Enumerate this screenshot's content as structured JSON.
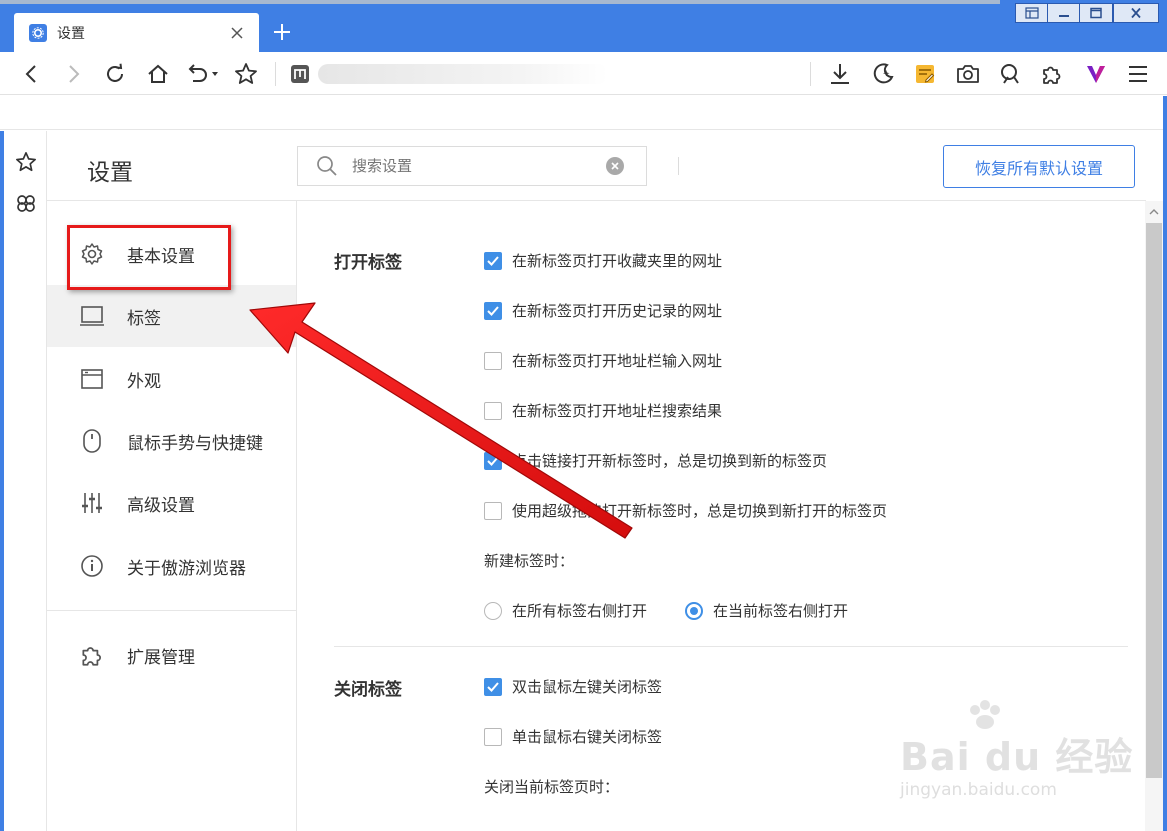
{
  "browser": {
    "tab_title": "设置",
    "colors": {
      "frame": "#3f7fe4",
      "accent": "#3f8fe6",
      "highlight": "#e61a1a"
    },
    "toolbar_icons": [
      "back-icon",
      "forward-icon",
      "reload-icon",
      "home-icon",
      "undo-icon",
      "bookmark-star-icon",
      "site-favicon",
      "download-icon",
      "night-mode-icon",
      "notes-icon",
      "screenshot-icon",
      "translate-icon",
      "extensions-icon",
      "v-logo-icon",
      "menu-icon"
    ]
  },
  "settings": {
    "title": "设置",
    "search": {
      "placeholder": "搜索设置"
    },
    "restore_label": "恢复所有默认设置"
  },
  "nav": {
    "items": [
      {
        "label": "基本设置",
        "icon": "gear-icon"
      },
      {
        "label": "标签",
        "icon": "tab-icon"
      },
      {
        "label": "外观",
        "icon": "window-icon"
      },
      {
        "label": "鼠标手势与快捷键",
        "icon": "mouse-icon"
      },
      {
        "label": "高级设置",
        "icon": "sliders-icon"
      },
      {
        "label": "关于傲游浏览器",
        "icon": "info-icon"
      },
      {
        "label": "扩展管理",
        "icon": "puzzle-icon"
      }
    ],
    "active_index": 1,
    "highlighted_index": 0
  },
  "sections": {
    "open_tabs": {
      "title": "打开标签",
      "options": [
        {
          "label": "在新标签页打开收藏夹里的网址",
          "checked": true
        },
        {
          "label": "在新标签页打开历史记录的网址",
          "checked": true
        },
        {
          "label": "在新标签页打开地址栏输入网址",
          "checked": false
        },
        {
          "label": "在新标签页打开地址栏搜索结果",
          "checked": false
        },
        {
          "label": "点击链接打开新标签时，总是切换到新的标签页",
          "checked": true
        },
        {
          "label": "使用超级拖拽打开新标签时，总是切换到新打开的标签页",
          "checked": false
        }
      ],
      "new_tab_label": "新建标签时：",
      "new_tab_radios": [
        {
          "label": "在所有标签右侧打开",
          "checked": false
        },
        {
          "label": "在当前标签右侧打开",
          "checked": true
        }
      ]
    },
    "close_tabs": {
      "title": "关闭标签",
      "options": [
        {
          "label": "双击鼠标左键关闭标签",
          "checked": true
        },
        {
          "label": "单击鼠标右键关闭标签",
          "checked": false
        }
      ],
      "close_current_label": "关闭当前标签页时："
    }
  },
  "watermark": {
    "main": "Bai du 经验",
    "sub": "jingyan.baidu.com"
  }
}
